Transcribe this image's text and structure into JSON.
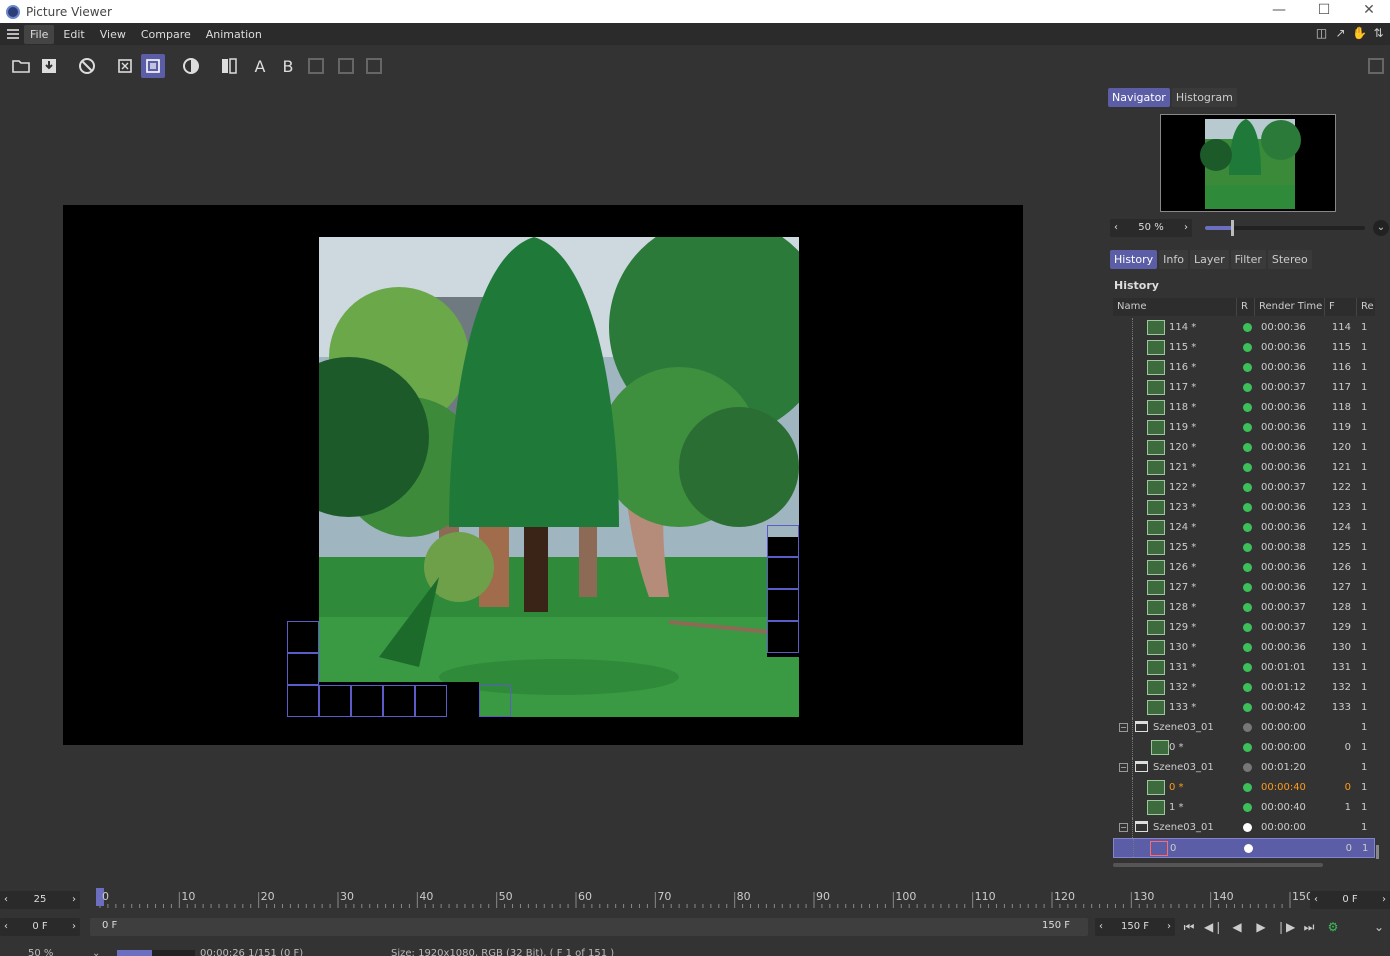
{
  "window": {
    "title": "Picture Viewer"
  },
  "menu": {
    "items": [
      "File",
      "Edit",
      "View",
      "Compare",
      "Animation"
    ]
  },
  "toolbar": {
    "text_a": "A",
    "text_b": "B"
  },
  "panel": {
    "top_tabs": [
      "Navigator",
      "Histogram"
    ],
    "zoom": "50 %",
    "zoom_slider_fraction": 0.17,
    "bottom_tabs": [
      "History",
      "Info",
      "Layer",
      "Filter",
      "Stereo"
    ],
    "history_title": "History",
    "columns": [
      "Name",
      "R",
      "Render Time",
      "F",
      "Re"
    ]
  },
  "history": [
    {
      "kind": "frame",
      "name": "114 *",
      "status": "green",
      "time": "00:00:36",
      "frame": "114",
      "re": "1"
    },
    {
      "kind": "frame",
      "name": "115 *",
      "status": "green",
      "time": "00:00:36",
      "frame": "115",
      "re": "1"
    },
    {
      "kind": "frame",
      "name": "116 *",
      "status": "green",
      "time": "00:00:36",
      "frame": "116",
      "re": "1"
    },
    {
      "kind": "frame",
      "name": "117 *",
      "status": "green",
      "time": "00:00:37",
      "frame": "117",
      "re": "1"
    },
    {
      "kind": "frame",
      "name": "118 *",
      "status": "green",
      "time": "00:00:36",
      "frame": "118",
      "re": "1"
    },
    {
      "kind": "frame",
      "name": "119 *",
      "status": "green",
      "time": "00:00:36",
      "frame": "119",
      "re": "1"
    },
    {
      "kind": "frame",
      "name": "120 *",
      "status": "green",
      "time": "00:00:36",
      "frame": "120",
      "re": "1"
    },
    {
      "kind": "frame",
      "name": "121 *",
      "status": "green",
      "time": "00:00:36",
      "frame": "121",
      "re": "1"
    },
    {
      "kind": "frame",
      "name": "122 *",
      "status": "green",
      "time": "00:00:37",
      "frame": "122",
      "re": "1"
    },
    {
      "kind": "frame",
      "name": "123 *",
      "status": "green",
      "time": "00:00:36",
      "frame": "123",
      "re": "1"
    },
    {
      "kind": "frame",
      "name": "124 *",
      "status": "green",
      "time": "00:00:36",
      "frame": "124",
      "re": "1"
    },
    {
      "kind": "frame",
      "name": "125 *",
      "status": "green",
      "time": "00:00:38",
      "frame": "125",
      "re": "1"
    },
    {
      "kind": "frame",
      "name": "126 *",
      "status": "green",
      "time": "00:00:36",
      "frame": "126",
      "re": "1"
    },
    {
      "kind": "frame",
      "name": "127 *",
      "status": "green",
      "time": "00:00:36",
      "frame": "127",
      "re": "1"
    },
    {
      "kind": "frame",
      "name": "128 *",
      "status": "green",
      "time": "00:00:37",
      "frame": "128",
      "re": "1"
    },
    {
      "kind": "frame",
      "name": "129 *",
      "status": "green",
      "time": "00:00:37",
      "frame": "129",
      "re": "1"
    },
    {
      "kind": "frame",
      "name": "130 *",
      "status": "green",
      "time": "00:00:36",
      "frame": "130",
      "re": "1"
    },
    {
      "kind": "frame",
      "name": "131 *",
      "status": "green",
      "time": "00:01:01",
      "frame": "131",
      "re": "1"
    },
    {
      "kind": "frame",
      "name": "132 *",
      "status": "green",
      "time": "00:01:12",
      "frame": "132",
      "re": "1"
    },
    {
      "kind": "frame",
      "name": "133 *",
      "status": "green",
      "time": "00:00:42",
      "frame": "133",
      "re": "1"
    },
    {
      "kind": "folder",
      "name": "Szene03_01",
      "status": "grey",
      "time": "00:00:00",
      "frame": "",
      "re": "1"
    },
    {
      "kind": "frame-small",
      "name": "0 *",
      "status": "green",
      "time": "00:00:00",
      "frame": "0",
      "re": "1"
    },
    {
      "kind": "folder",
      "name": "Szene03_01",
      "status": "grey",
      "time": "00:01:20",
      "frame": "",
      "re": "1"
    },
    {
      "kind": "frame",
      "name": "0 *",
      "status": "green",
      "time": "00:00:40",
      "frame": "0",
      "re": "1",
      "highlight": true
    },
    {
      "kind": "frame",
      "name": "1 *",
      "status": "green",
      "time": "00:00:40",
      "frame": "1",
      "re": "1"
    },
    {
      "kind": "folder",
      "name": "Szene03_01",
      "status": "white",
      "time": "00:00:00",
      "frame": "",
      "re": "1"
    },
    {
      "kind": "rendering",
      "name": "0",
      "status": "white",
      "time": "",
      "frame": "0",
      "re": "1",
      "selected": true
    }
  ],
  "timeline": {
    "fps": "25",
    "ticks": [
      "0",
      "10",
      "20",
      "30",
      "40",
      "50",
      "60",
      "70",
      "80",
      "90",
      "100",
      "110",
      "120",
      "130",
      "140",
      "150"
    ],
    "current_frame": "0 F",
    "start_field": "0 F",
    "range_start": "0 F",
    "range_end": "150 F",
    "end_field": "150 F"
  },
  "status": {
    "zoom": "50 %",
    "progress_fraction": 0.45,
    "time": "00:00:26 1/151 (0 F)",
    "info": "Size: 1920x1080, RGB (32 Bit), ( F 1 of 151 )"
  }
}
